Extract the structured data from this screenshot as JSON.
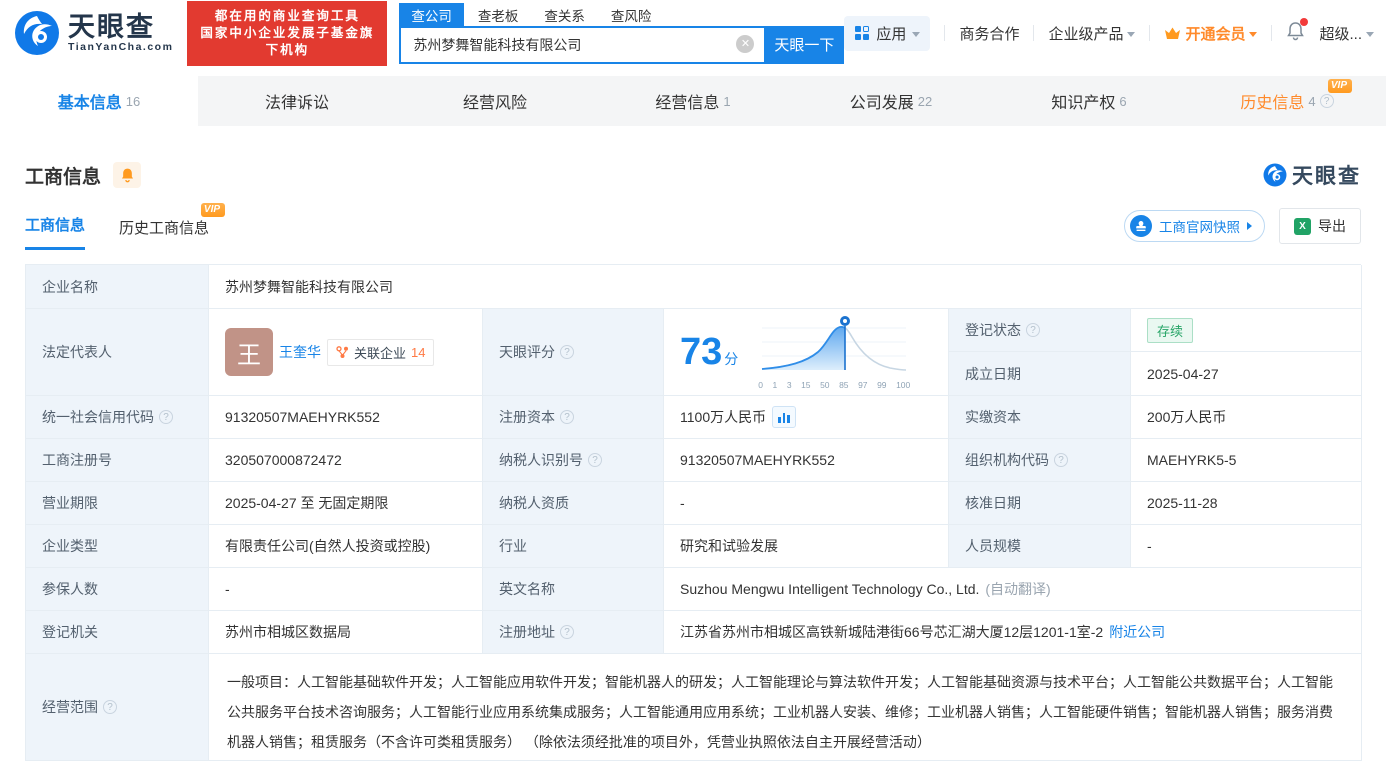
{
  "header": {
    "logo": {
      "brand": "天眼查",
      "domain": "TianYanCha.com"
    },
    "banner": {
      "line1": "都在用的商业查询工具",
      "line2": "国家中小企业发展子基金旗下机构"
    },
    "search": {
      "tabs": [
        {
          "label": "查公司"
        },
        {
          "label": "查老板"
        },
        {
          "label": "查关系"
        },
        {
          "label": "查风险"
        }
      ],
      "value": "苏州梦舞智能科技有限公司",
      "button": "天眼一下"
    },
    "menu": {
      "apps": "应用",
      "cooperation": "商务合作",
      "enterprise": "企业级产品",
      "vip": "开通会员",
      "more": "超级..."
    }
  },
  "nav_tabs": [
    {
      "label": "基本信息",
      "count": "16"
    },
    {
      "label": "法律诉讼",
      "count": ""
    },
    {
      "label": "经营风险",
      "count": ""
    },
    {
      "label": "经营信息",
      "count": "1"
    },
    {
      "label": "公司发展",
      "count": "22"
    },
    {
      "label": "知识产权",
      "count": "6"
    },
    {
      "label": "历史信息",
      "count": "4",
      "vip": "VIP"
    }
  ],
  "section": {
    "title": "工商信息",
    "subtabs": [
      {
        "label": "工商信息"
      },
      {
        "label": "历史工商信息",
        "vip": "VIP"
      }
    ],
    "snapshot_button": "工商官网快照",
    "export_button": "导出",
    "watermark": "天眼查"
  },
  "table": {
    "company_name_label": "企业名称",
    "company_name": "苏州梦舞智能科技有限公司",
    "legal_rep_label": "法定代表人",
    "legal_rep_avatar": "王",
    "legal_rep_name": "王奎华",
    "related_label": "关联企业",
    "related_count": "14",
    "reg_status_label": "登记状态",
    "reg_status": "存续",
    "establish_date_label": "成立日期",
    "establish_date": "2025-04-27",
    "score_label": "天眼评分",
    "score": "73",
    "score_unit": "分",
    "score_ticks": [
      "0",
      "1",
      "3",
      "15",
      "50",
      "85",
      "97",
      "99",
      "100"
    ],
    "credit_code_label": "统一社会信用代码",
    "credit_code": "91320507MAEHYRK552",
    "reg_capital_label": "注册资本",
    "reg_capital": "1100万人民币",
    "paid_capital_label": "实缴资本",
    "paid_capital": "200万人民币",
    "reg_number_label": "工商注册号",
    "reg_number": "320507000872472",
    "taxpayer_id_label": "纳税人识别号",
    "taxpayer_id": "91320507MAEHYRK552",
    "org_code_label": "组织机构代码",
    "org_code": "MAEHYRK5-5",
    "business_term_label": "营业期限",
    "business_term": "2025-04-27 至 无固定期限",
    "taxpayer_quality_label": "纳税人资质",
    "taxpayer_quality": "-",
    "approval_date_label": "核准日期",
    "approval_date": "2025-11-28",
    "company_type_label": "企业类型",
    "company_type": "有限责任公司(自然人投资或控股)",
    "industry_label": "行业",
    "industry": "研究和试验发展",
    "staff_size_label": "人员规模",
    "staff_size": "-",
    "insured_label": "参保人数",
    "insured": "-",
    "english_name_label": "英文名称",
    "english_name": "Suzhou Mengwu Intelligent Technology Co., Ltd.",
    "english_name_note": "(自动翻译)",
    "reg_authority_label": "登记机关",
    "reg_authority": "苏州市相城区数据局",
    "address_label": "注册地址",
    "address": "江苏省苏州市相城区高铁新城陆港街66号芯汇湖大厦12层1201-1室-2",
    "nearby_link": "附近公司",
    "business_scope_label": "经营范围",
    "business_scope": "一般项目：人工智能基础软件开发；人工智能应用软件开发；智能机器人的研发；人工智能理论与算法软件开发；人工智能基础资源与技术平台；人工智能公共数据平台；人工智能公共服务平台技术咨询服务；人工智能行业应用系统集成服务；人工智能通用应用系统；工业机器人安装、维修；工业机器人销售；人工智能硬件销售；智能机器人销售；服务消费机器人销售；租赁服务（不含许可类租赁服务） （除依法须经批准的项目外，凭营业执照依法自主开展经营活动）"
  },
  "colors": {
    "primary_blue": "#1884e7",
    "banner_red": "#e23a30",
    "vip_orange": "#ff9a1f",
    "status_green": "#27a567"
  }
}
